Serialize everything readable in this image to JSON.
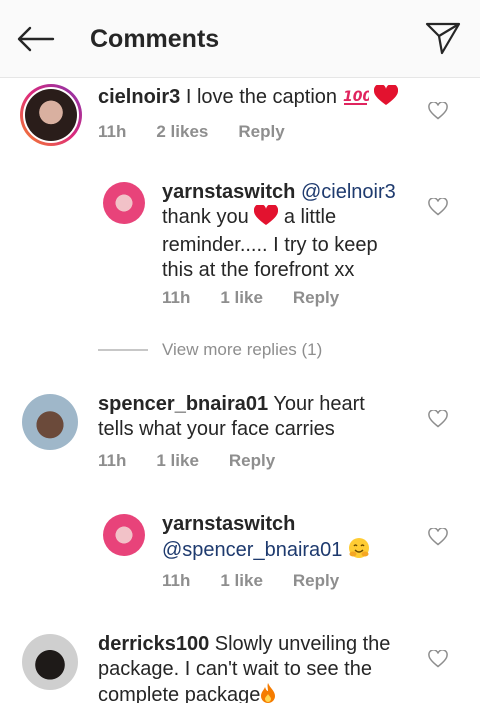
{
  "header": {
    "title": "Comments"
  },
  "comments": [
    {
      "username": "cielnoir3",
      "text": "I love the caption",
      "time": "11h",
      "likes": "2 likes",
      "reply": "Reply"
    },
    {
      "username": "yarnstaswitch",
      "mention": "@cielnoir3",
      "text_a": "thank you",
      "text_b": "a little",
      "text_c": "reminder..... I try to keep",
      "text_d": "this at the forefront xx",
      "time": "11h",
      "likes": "1 like",
      "reply": "Reply"
    },
    {
      "username": "spencer_bnaira01",
      "text_a": "Your heart",
      "text_b": "tells what your face carries",
      "time": "11h",
      "likes": "1 like",
      "reply": "Reply"
    },
    {
      "username": "yarnstaswitch",
      "mention": "@spencer_bnaira01",
      "time": "11h",
      "likes": "1 like",
      "reply": "Reply"
    },
    {
      "username": "derricks100",
      "text_a": "Slowly unveiling the",
      "text_b": "package. I can't wait to see the",
      "text_c": "complete package"
    }
  ],
  "view_more": "View more replies (1)",
  "icons": [
    "back-arrow-icon",
    "direct-send-icon",
    "like-heart-icon",
    "red-heart-emoji",
    "hundred-emoji",
    "hugging-emoji",
    "fire-emoji"
  ],
  "colors": {
    "mention": "#1e3a6e",
    "meta": "#8e8e8e",
    "story_ring_start": "#f58529",
    "story_ring_end": "#dd2a7b"
  }
}
